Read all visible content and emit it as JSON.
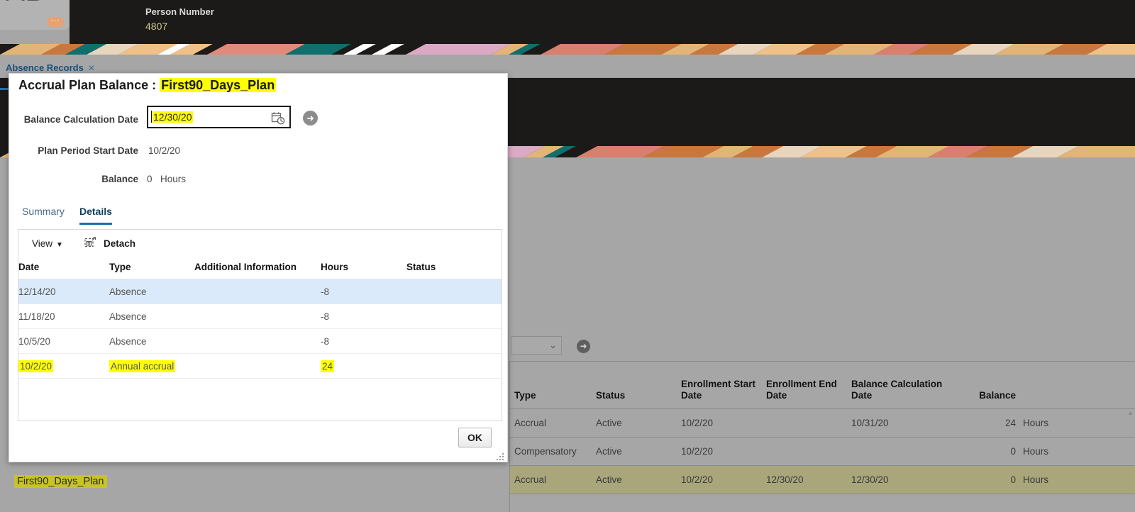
{
  "person_header": {
    "avatar_initials": "AB",
    "avatar_badge": "···",
    "label": "Person Number",
    "value": "4807"
  },
  "tabbar": {
    "tab_label": "Absence Records",
    "close_glyph": "✕"
  },
  "background_toolbar": {
    "select_value": "",
    "chevron_glyph": "⌄",
    "go_glyph": "➜"
  },
  "background_table": {
    "columns": [
      "Type",
      "Status",
      "Enrollment Start Date",
      "Enrollment End Date",
      "Balance Calculation Date",
      "Balance",
      ""
    ],
    "rows": [
      {
        "type": "Accrual",
        "status": "Active",
        "enrollment_start_date": "10/2/20",
        "enrollment_end_date": "",
        "balance_calculation_date": "10/31/20",
        "balance": "24",
        "unit": "Hours",
        "highlighted": false
      },
      {
        "type": "Compensatory",
        "status": "Active",
        "enrollment_start_date": "10/2/20",
        "enrollment_end_date": "",
        "balance_calculation_date": "",
        "balance": "0",
        "unit": "Hours",
        "highlighted": false
      },
      {
        "type": "Accrual",
        "status": "Active",
        "enrollment_start_date": "10/2/20",
        "enrollment_end_date": "12/30/20",
        "balance_calculation_date": "12/30/20",
        "balance": "0",
        "unit": "Hours",
        "highlighted": true
      }
    ],
    "scroll_up_glyph": "▲",
    "plan_name_row_label": "First90_Days_Plan"
  },
  "dialog": {
    "title_prefix": "Accrual Plan Balance : ",
    "title_plan": "First90_Days_Plan",
    "balance_calculation_date_label": "Balance Calculation Date",
    "balance_calculation_date_value": "12/30/20",
    "calendar_icon": "calendar-clock-icon",
    "go_glyph": "➜",
    "plan_period_start_date_label": "Plan Period Start Date",
    "plan_period_start_date_value": "10/2/20",
    "balance_label": "Balance",
    "balance_value": "0",
    "balance_unit": "Hours",
    "tabs": [
      {
        "label": "Summary",
        "active": false
      },
      {
        "label": "Details",
        "active": true
      }
    ],
    "toolbar": {
      "view_label": "View",
      "view_caret": "▼",
      "detach_label": "Detach"
    },
    "table": {
      "columns": [
        "Date",
        "Type",
        "Additional Information",
        "Hours",
        "Status"
      ],
      "rows": [
        {
          "date": "12/14/20",
          "type": "Absence",
          "additional_information": "",
          "hours": "-8",
          "status": "",
          "selected": true,
          "highlight": false
        },
        {
          "date": "11/18/20",
          "type": "Absence",
          "additional_information": "",
          "hours": "-8",
          "status": "",
          "selected": false,
          "highlight": false
        },
        {
          "date": "10/5/20",
          "type": "Absence",
          "additional_information": "",
          "hours": "-8",
          "status": "",
          "selected": false,
          "highlight": false
        },
        {
          "date": "10/2/20",
          "type": "Annual accrual",
          "additional_information": "",
          "hours": "24",
          "status": "",
          "selected": false,
          "highlight": true
        }
      ]
    },
    "ok_label": "OK"
  },
  "colors": {
    "highlight_yellow": "#ffff00",
    "marker_olive": "#c8c428",
    "link_blue": "#18507c",
    "tab_accent": "#1d6fa5",
    "selected_row": "#daeafa",
    "page_gray": "#a6a6a6",
    "hero_dark": "#1c1a19"
  }
}
